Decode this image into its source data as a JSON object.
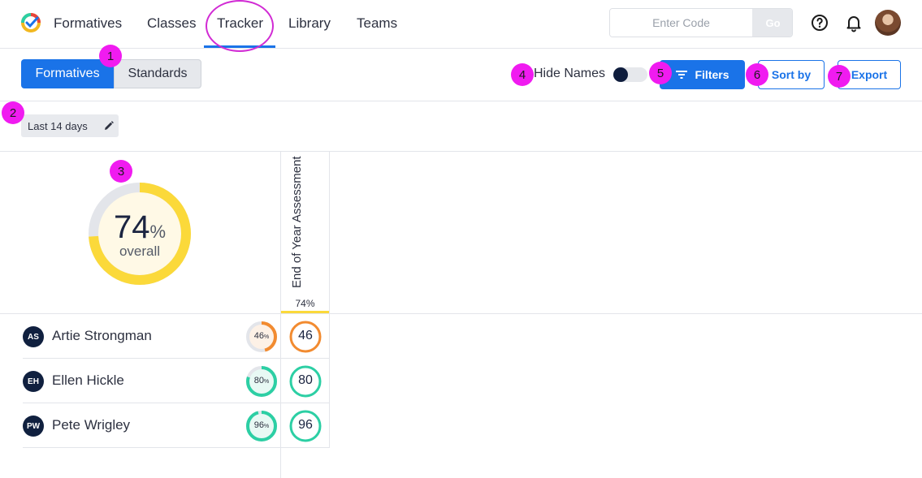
{
  "nav": {
    "items": [
      "Formatives",
      "Classes",
      "Tracker",
      "Library",
      "Teams"
    ],
    "active": "Tracker",
    "code_placeholder": "Enter Code",
    "go_label": "Go",
    "help_icon": "help-circle-icon",
    "bell_icon": "bell-icon"
  },
  "toolbar": {
    "seg_formatives": "Formatives",
    "seg_standards": "Standards",
    "hide_names": "Hide Names",
    "filters": "Filters",
    "sort_by": "Sort by",
    "export": "Export"
  },
  "date_filter": {
    "label": "Last 14 days",
    "icon": "pencil-icon"
  },
  "summary": {
    "overall_value": "74",
    "overall_unit": "%",
    "overall_label": "overall",
    "overall_fraction": 0.74
  },
  "assessment": {
    "title": "End of Year Assessment",
    "average": "74%"
  },
  "students": [
    {
      "initials": "AS",
      "name": "Artie Strongman",
      "overall": "46",
      "score": "46",
      "fraction": 0.46,
      "color": "#f28b30"
    },
    {
      "initials": "EH",
      "name": "Ellen Hickle",
      "overall": "80",
      "score": "80",
      "fraction": 0.8,
      "color": "#2ccfa4"
    },
    {
      "initials": "PW",
      "name": "Pete Wrigley",
      "overall": "96",
      "score": "96",
      "fraction": 0.96,
      "color": "#2ccfa4"
    }
  ],
  "badges": [
    "1",
    "2",
    "3",
    "4",
    "5",
    "6",
    "7"
  ],
  "colors": {
    "accent": "#1a73e8",
    "donut_fill": "#fbd93a",
    "donut_track": "#e3e5ea",
    "badge": "#f01bf0",
    "annotation_circle": "#d12bd4"
  }
}
